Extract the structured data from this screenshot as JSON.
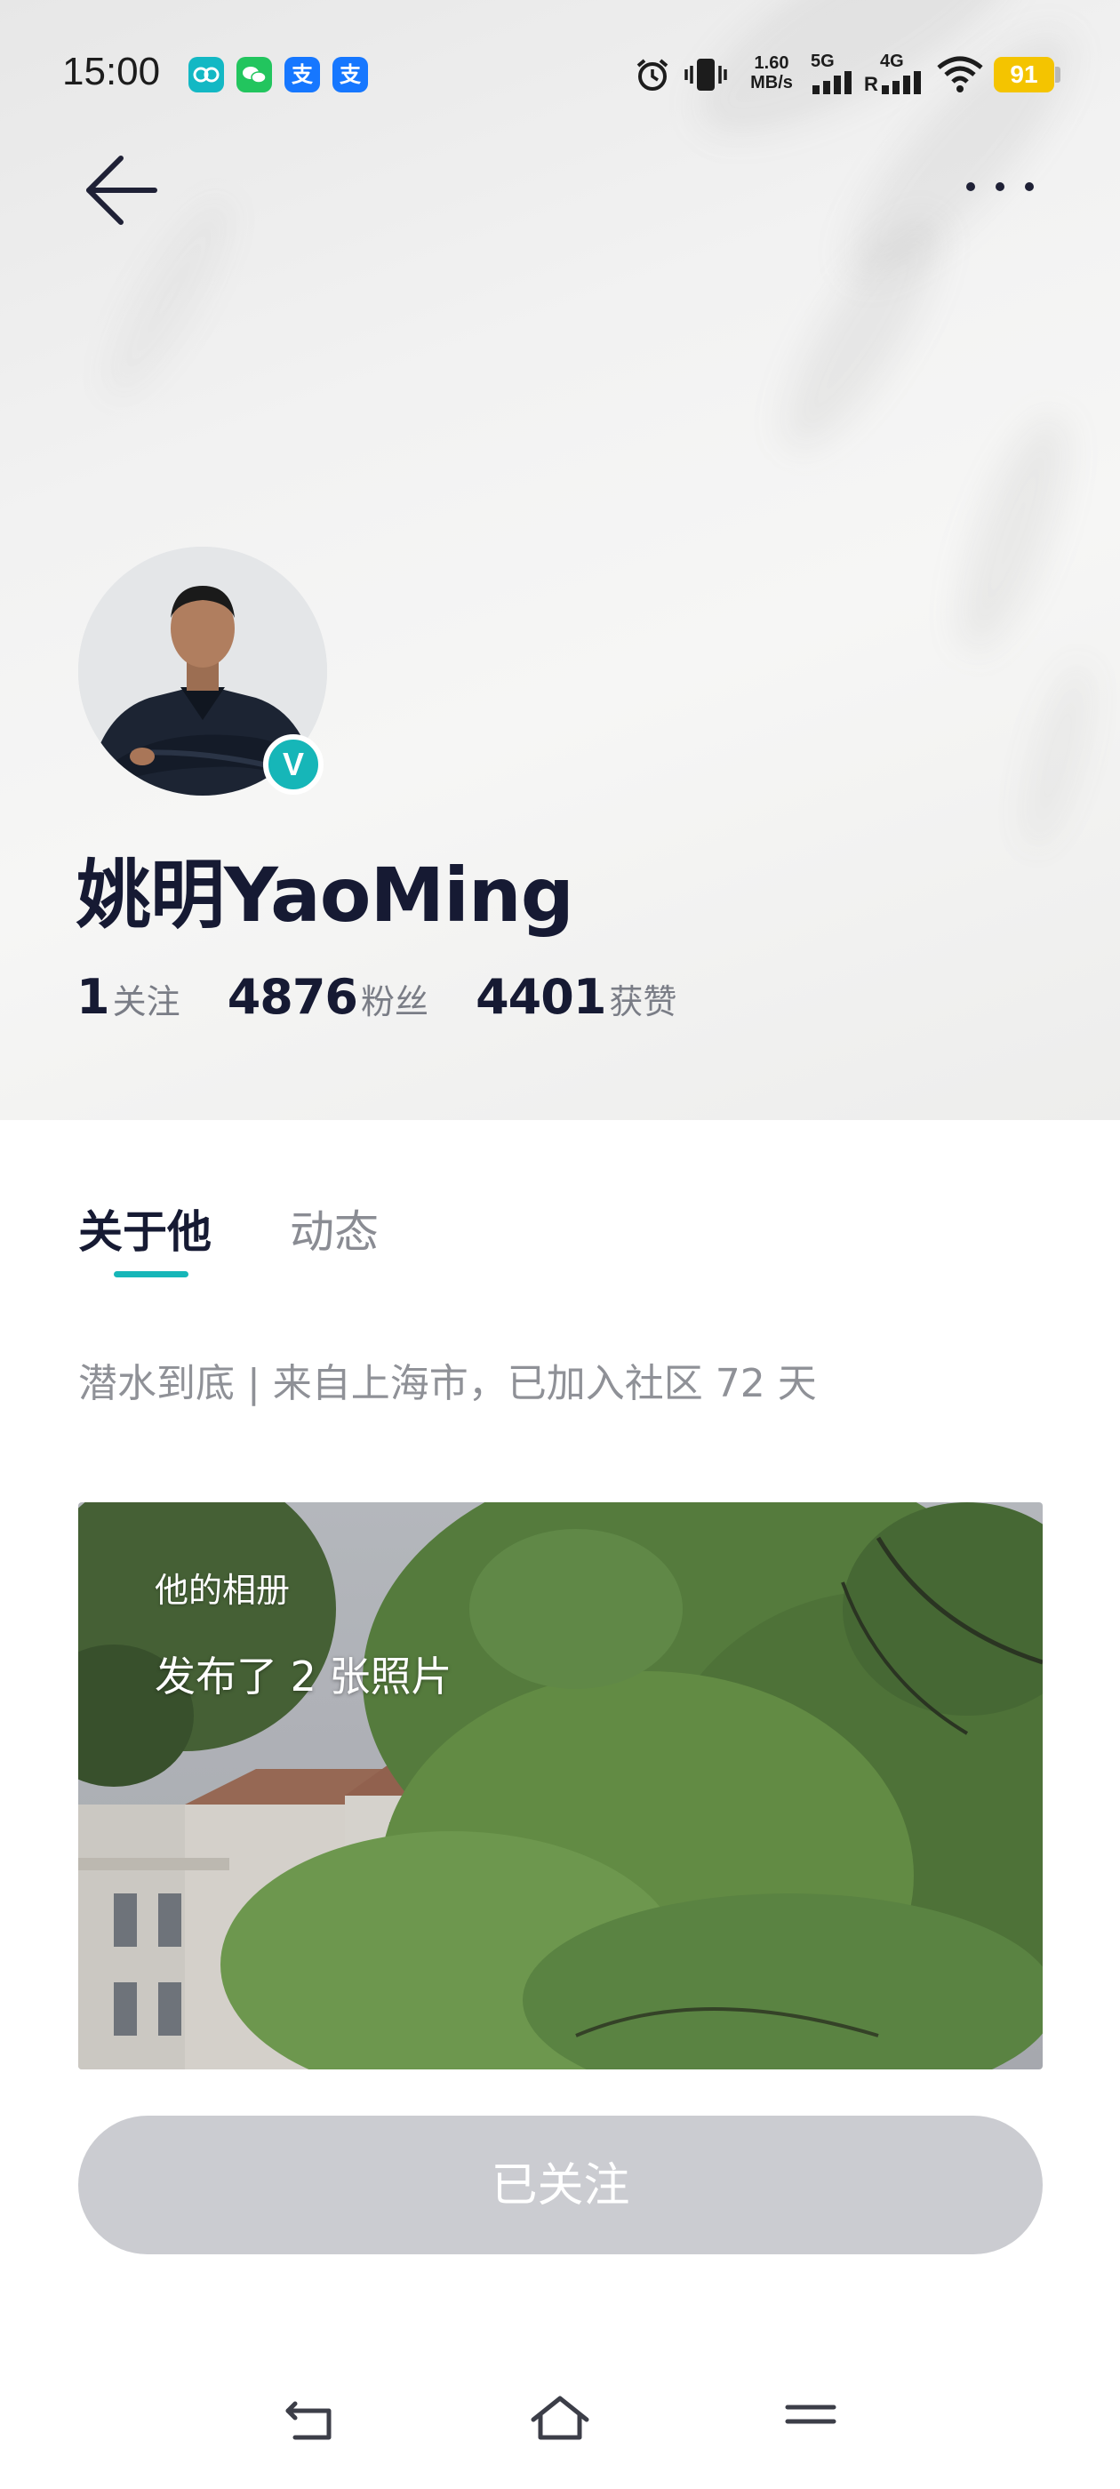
{
  "status_bar": {
    "time": "15:00",
    "app_icons": [
      "transit-app-icon",
      "wechat-icon",
      "alipay-icon",
      "alipay-icon"
    ],
    "net_speed_value": "1.60",
    "net_speed_unit": "MB/s",
    "signal_5g": "5G",
    "signal_4g": "4G",
    "signal_4g_r": "R",
    "battery": "91",
    "colors": {
      "battery": "#f4c400",
      "wechat": "#22c55e",
      "transit": "#13b8c4",
      "alipay": "#1677ff"
    }
  },
  "nav": {
    "back_icon": "arrow-left-icon",
    "more_icon": "more-dots-icon"
  },
  "profile": {
    "name": "姚明YaoMing",
    "verified_mark": "V",
    "stats": [
      {
        "value": "1",
        "label": "关注"
      },
      {
        "value": "4876",
        "label": "粉丝"
      },
      {
        "value": "4401",
        "label": "获赞"
      }
    ]
  },
  "tabs": [
    {
      "label": "关于他",
      "active": true
    },
    {
      "label": "动态",
      "active": false
    }
  ],
  "bio": "潜水到底 | 来自上海市，已加入社区 72 天",
  "album": {
    "title": "他的相册",
    "count_text": "发布了 2 张照片"
  },
  "follow_button": "已关注",
  "accent_color": "#16b6b8",
  "bottom_nav": [
    "back-nav-icon",
    "home-nav-icon",
    "menu-nav-icon"
  ]
}
